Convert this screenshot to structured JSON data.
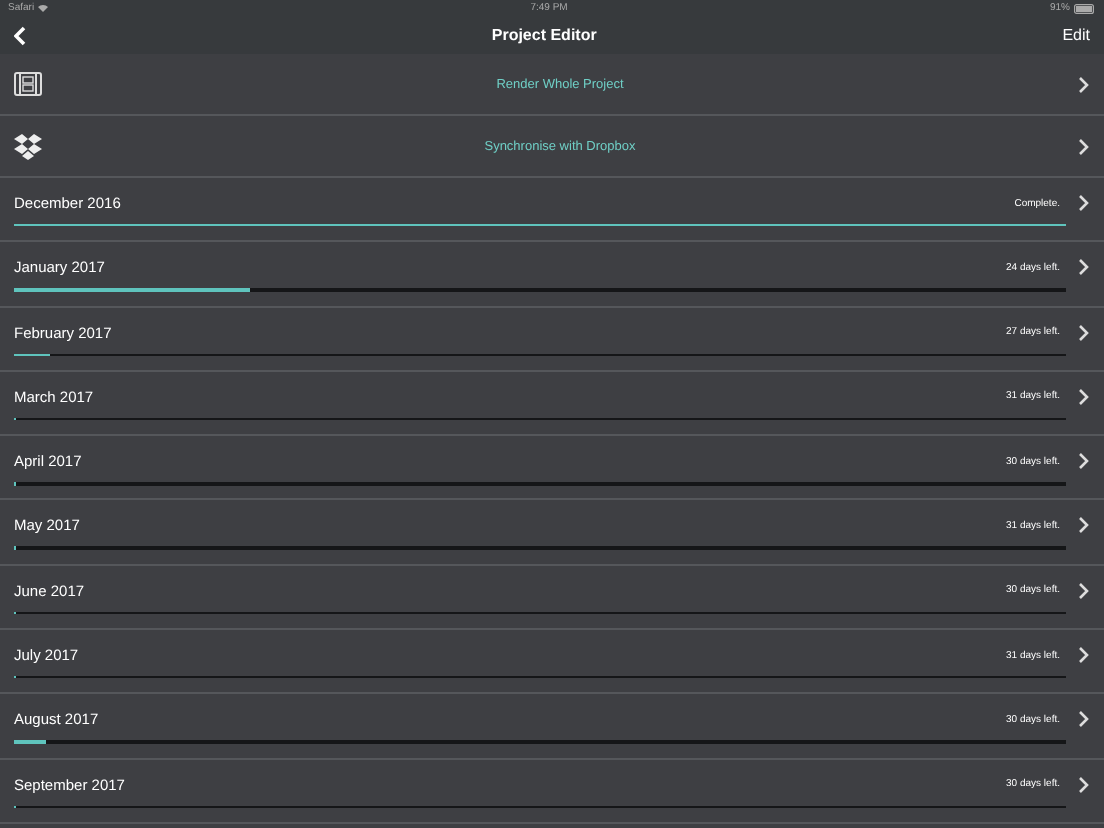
{
  "status_bar": {
    "app": "Safari",
    "time": "7:49 PM",
    "battery": "91%"
  },
  "nav": {
    "title": "Project Editor",
    "edit": "Edit"
  },
  "actions": [
    {
      "kind": "film",
      "label": "Render Whole Project"
    },
    {
      "kind": "dropbox",
      "label": "Synchronise with Dropbox"
    }
  ],
  "months": [
    {
      "name": "December 2016",
      "status": "Complete.",
      "level": 1
    },
    {
      "name": "January 2017",
      "status": "24 days left.",
      "level": 0.225
    },
    {
      "name": "February 2017",
      "status": "27 days left.",
      "level": 0.035
    },
    {
      "name": "March 2017",
      "status": "31 days left.",
      "level": 0
    },
    {
      "name": "April 2017",
      "status": "30 days left.",
      "level": 0
    },
    {
      "name": "May 2017",
      "status": "31 days left.",
      "level": 0
    },
    {
      "name": "June 2017",
      "status": "30 days left.",
      "level": 0
    },
    {
      "name": "July 2017",
      "status": "31 days left.",
      "level": 0
    },
    {
      "name": "August 2017",
      "status": "30 days left.",
      "level": 0.03
    },
    {
      "name": "September 2017",
      "status": "30 days left.",
      "level": 0
    }
  ]
}
